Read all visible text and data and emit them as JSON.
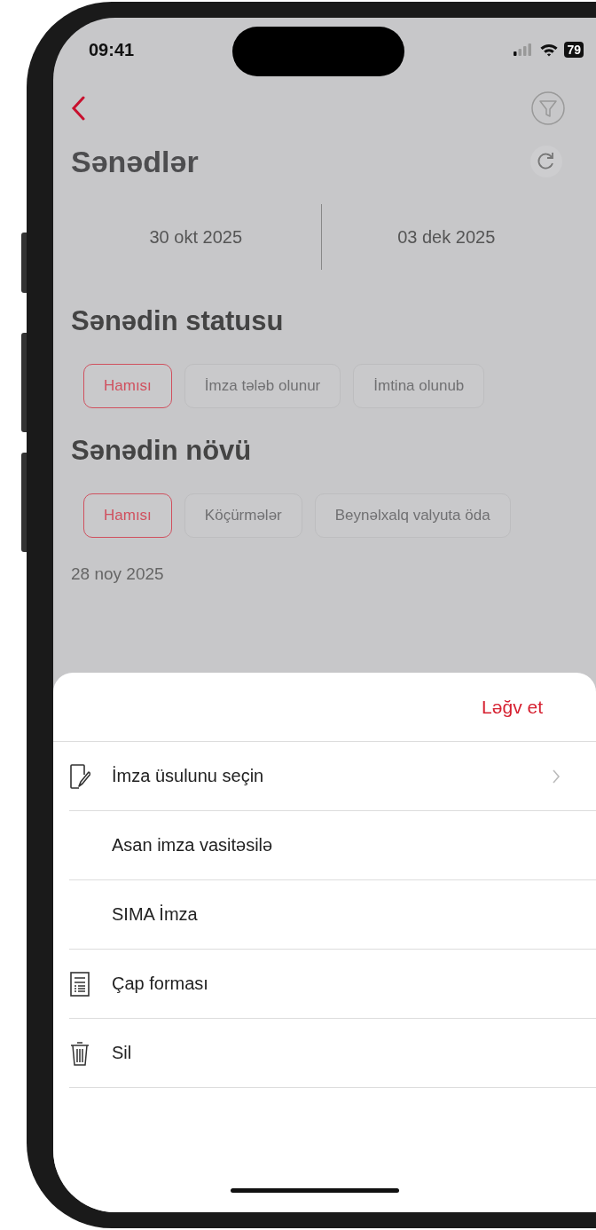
{
  "status_bar": {
    "time": "09:41",
    "battery": "79"
  },
  "header": {
    "title": "Sənədlər"
  },
  "date_range": {
    "from": "30 okt 2025",
    "to": "03 dek 2025"
  },
  "status_filter": {
    "title": "Sənədin statusu",
    "chips": [
      {
        "label": "Hamısı",
        "selected": true
      },
      {
        "label": "İmza tələb olunur",
        "selected": false
      },
      {
        "label": "İmtina olunub",
        "selected": false
      }
    ]
  },
  "type_filter": {
    "title": "Sənədin növü",
    "chips": [
      {
        "label": "Hamısı",
        "selected": true
      },
      {
        "label": "Köçürmələr",
        "selected": false
      },
      {
        "label": "Beynəlxalq valyuta öda",
        "selected": false
      }
    ]
  },
  "list": {
    "date_heading": "28 noy 2025"
  },
  "action_sheet": {
    "cancel": "Ləğv et",
    "items": [
      {
        "label": "İmza üsulunu seçin",
        "kind": "sign",
        "chevron": true
      },
      {
        "label": "Asan imza vasitəsilə",
        "kind": "option",
        "chevron": false
      },
      {
        "label": "SIMA İmza",
        "kind": "option",
        "chevron": false
      },
      {
        "label": "Çap forması",
        "kind": "print",
        "chevron": false
      },
      {
        "label": "Sil",
        "kind": "delete",
        "chevron": false
      }
    ]
  }
}
